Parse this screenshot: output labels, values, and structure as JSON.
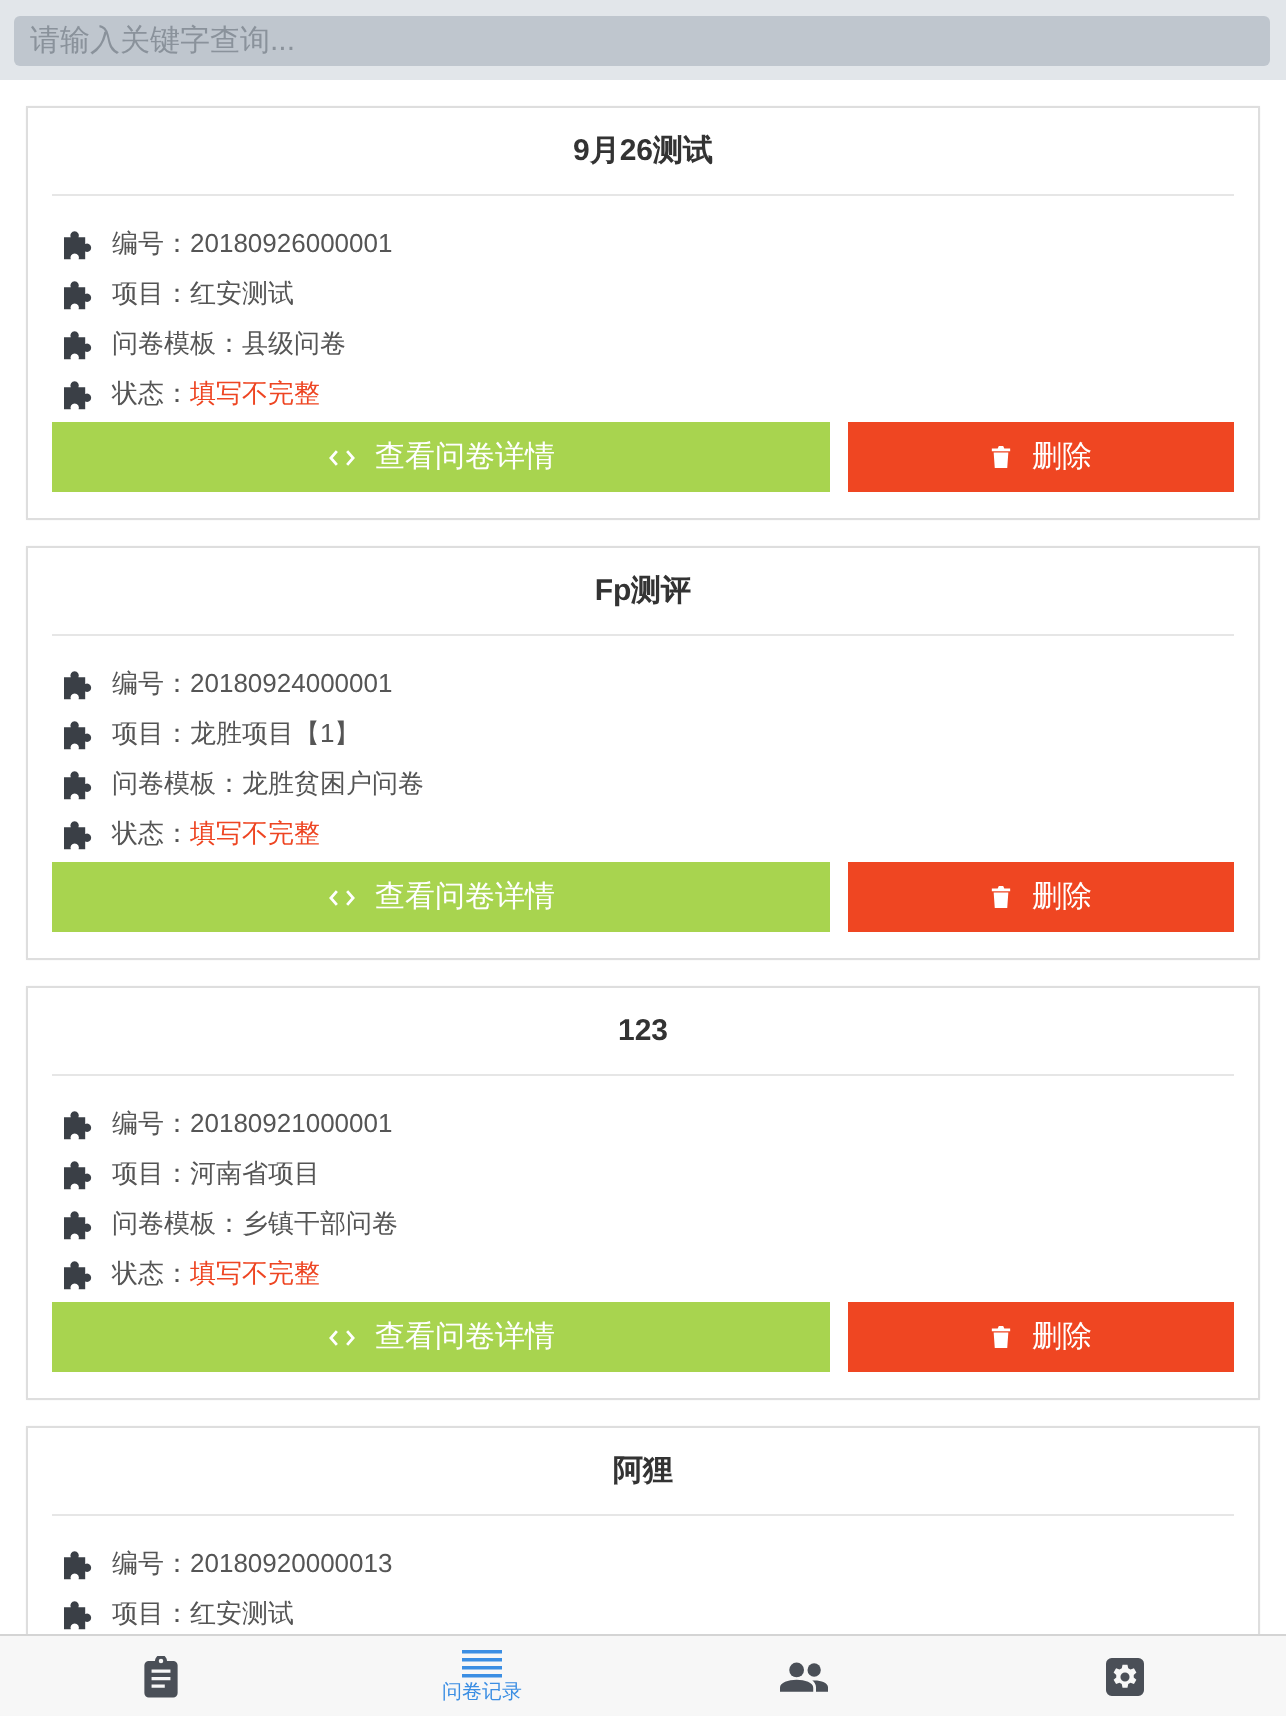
{
  "search": {
    "placeholder": "请输入关键字查询..."
  },
  "records": [
    {
      "title": "9月26测试",
      "fields": [
        {
          "kind": "text",
          "label": "编号：",
          "value": "20180926000001"
        },
        {
          "kind": "text",
          "label": "项目：",
          "value": "红安测试"
        },
        {
          "kind": "text",
          "label": "问卷模板：",
          "value": "县级问卷"
        },
        {
          "kind": "status",
          "label": "状态：",
          "value": "填写不完整"
        }
      ],
      "buttons": [
        {
          "kind": "view",
          "label": "查看问卷详情"
        },
        {
          "kind": "delete",
          "label": "删除"
        }
      ]
    },
    {
      "title": "Fp测评",
      "fields": [
        {
          "kind": "text",
          "label": "编号：",
          "value": "20180924000001"
        },
        {
          "kind": "text",
          "label": "项目：",
          "value": "龙胜项目【1】"
        },
        {
          "kind": "text",
          "label": "问卷模板：",
          "value": "龙胜贫困户问卷"
        },
        {
          "kind": "status",
          "label": "状态：",
          "value": "填写不完整"
        }
      ],
      "buttons": [
        {
          "kind": "view",
          "label": "查看问卷详情"
        },
        {
          "kind": "delete",
          "label": "删除"
        }
      ]
    },
    {
      "title": "123",
      "fields": [
        {
          "kind": "text",
          "label": "编号：",
          "value": "20180921000001"
        },
        {
          "kind": "text",
          "label": "项目：",
          "value": "河南省项目"
        },
        {
          "kind": "text",
          "label": "问卷模板：",
          "value": "乡镇干部问卷"
        },
        {
          "kind": "status",
          "label": "状态：",
          "value": "填写不完整"
        }
      ],
      "buttons": [
        {
          "kind": "view",
          "label": "查看问卷详情"
        },
        {
          "kind": "delete",
          "label": "删除"
        }
      ]
    },
    {
      "title": "阿狸",
      "fields": [
        {
          "kind": "text",
          "label": "编号：",
          "value": "20180920000013"
        },
        {
          "kind": "text",
          "label": "项目：",
          "value": "红安测试"
        }
      ]
    }
  ],
  "tab_bar": {
    "items": [
      {
        "selected": false
      },
      {
        "selected": true,
        "label": "问卷记录"
      },
      {
        "selected": false
      },
      {
        "selected": false
      }
    ]
  }
}
